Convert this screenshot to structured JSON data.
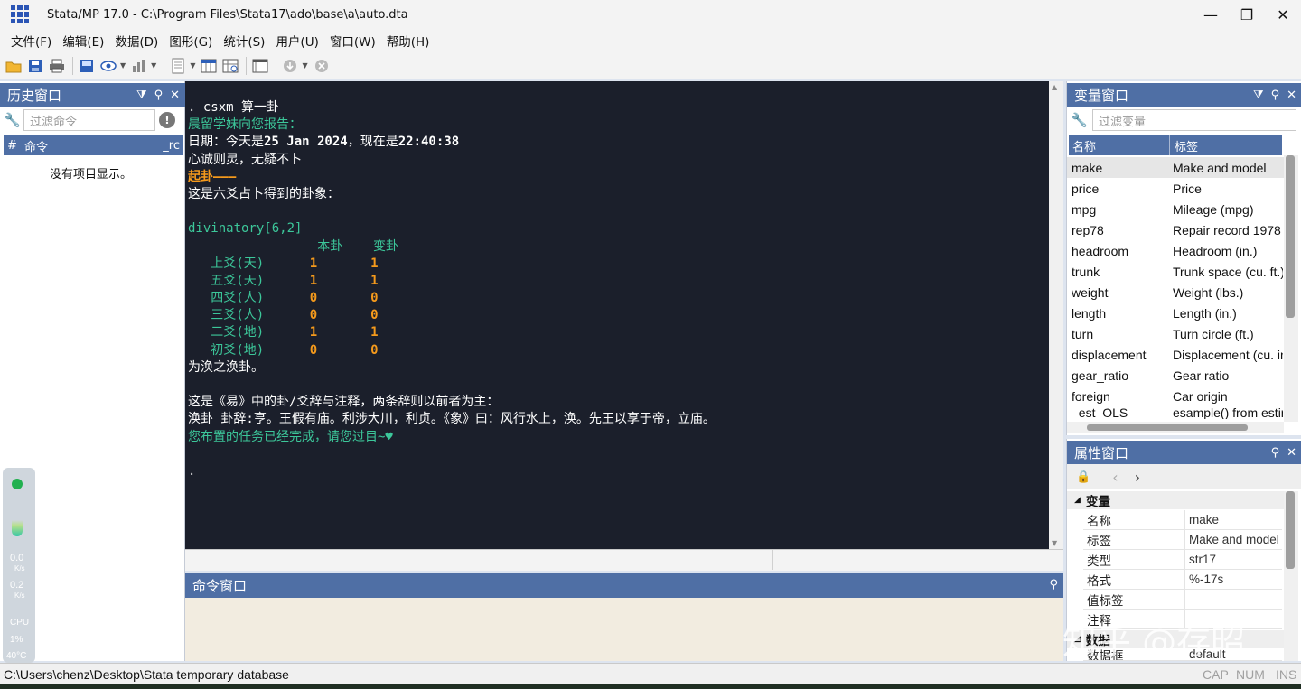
{
  "window": {
    "title": "Stata/MP 17.0 - C:\\Program Files\\Stata17\\ado\\base\\a\\auto.dta",
    "minimize": "—",
    "restore": "❐",
    "close": "✕"
  },
  "menu": [
    "文件(F)",
    "编辑(E)",
    "数据(D)",
    "图形(G)",
    "统计(S)",
    "用户(U)",
    "窗口(W)",
    "帮助(H)"
  ],
  "history": {
    "title": "历史窗口",
    "filter_placeholder": "过滤命令",
    "col_num": "#",
    "col_cmd": "命令",
    "col_rc": "_rc",
    "empty": "没有项目显示。"
  },
  "results": {
    "lines": [
      [
        {
          "t": ". csxm 算一卦",
          "c": "white"
        }
      ],
      [
        {
          "t": "晨留学妹向您报告：",
          "c": "green"
        }
      ],
      [
        {
          "t": "日期：今天是",
          "c": "white"
        },
        {
          "t": "25 Jan 2024",
          "c": "bold"
        },
        {
          "t": "，现在是",
          "c": "white"
        },
        {
          "t": "22:40:38",
          "c": "bold"
        }
      ],
      [
        {
          "t": "心诚则灵，无疑不卜",
          "c": "white"
        }
      ],
      [
        {
          "t": "起卦———",
          "c": "orange"
        }
      ],
      [
        {
          "t": "这是六爻占卜得到的卦象：",
          "c": "white"
        }
      ],
      [
        {
          "t": "",
          "c": "white"
        }
      ],
      [
        {
          "t": "divinatory[6,2]",
          "c": "green"
        }
      ],
      [
        {
          "t": "                 本卦    变卦",
          "c": "green"
        }
      ],
      [
        {
          "t": "   上爻(天)      ",
          "c": "green"
        },
        {
          "t": "1       1",
          "c": "orange"
        }
      ],
      [
        {
          "t": "   五爻(天)      ",
          "c": "green"
        },
        {
          "t": "1       1",
          "c": "orange"
        }
      ],
      [
        {
          "t": "   四爻(人)      ",
          "c": "green"
        },
        {
          "t": "0       0",
          "c": "orange"
        }
      ],
      [
        {
          "t": "   三爻(人)      ",
          "c": "green"
        },
        {
          "t": "0       0",
          "c": "orange"
        }
      ],
      [
        {
          "t": "   二爻(地)      ",
          "c": "green"
        },
        {
          "t": "1       1",
          "c": "orange"
        }
      ],
      [
        {
          "t": "   初爻(地)      ",
          "c": "green"
        },
        {
          "t": "0       0",
          "c": "orange"
        }
      ],
      [
        {
          "t": "为涣之涣卦。",
          "c": "white"
        }
      ],
      [
        {
          "t": "",
          "c": "white"
        }
      ],
      [
        {
          "t": "这是《易》中的卦/爻辞与注释，两条辞则以前者为主：",
          "c": "white"
        }
      ],
      [
        {
          "t": "涣卦 卦辞:亨。王假有庙。利涉大川，利贞。《象》曰：风行水上，涣。先王以享于帝，立庙。",
          "c": "white"
        }
      ],
      [
        {
          "t": "您布置的任务已经完成，请您过目~♥",
          "c": "green"
        }
      ],
      [
        {
          "t": "",
          "c": "white"
        }
      ],
      [
        {
          "t": ".",
          "c": "white"
        }
      ]
    ]
  },
  "command": {
    "title": "命令窗口"
  },
  "variables": {
    "title": "变量窗口",
    "filter_placeholder": "过滤变量",
    "col_name": "名称",
    "col_label": "标签",
    "rows": [
      {
        "name": "make",
        "label": "Make and model"
      },
      {
        "name": "price",
        "label": "Price"
      },
      {
        "name": "mpg",
        "label": "Mileage (mpg)"
      },
      {
        "name": "rep78",
        "label": "Repair record 1978"
      },
      {
        "name": "headroom",
        "label": "Headroom (in.)"
      },
      {
        "name": "trunk",
        "label": "Trunk space (cu. ft.)"
      },
      {
        "name": "weight",
        "label": "Weight (lbs.)"
      },
      {
        "name": "length",
        "label": "Length (in.)"
      },
      {
        "name": "turn",
        "label": "Turn circle (ft.)"
      },
      {
        "name": "displacement",
        "label": "Displacement (cu. in.)"
      },
      {
        "name": "gear_ratio",
        "label": "Gear ratio"
      },
      {
        "name": "foreign",
        "label": "Car origin"
      },
      {
        "name": "_est_OLS",
        "label": "esample() from estimates"
      }
    ]
  },
  "properties": {
    "title": "属性窗口",
    "section_var": "变量",
    "section_data": "数据",
    "rows": [
      {
        "name": "名称",
        "value": "make"
      },
      {
        "name": "标签",
        "value": "Make and model"
      },
      {
        "name": "类型",
        "value": "str17"
      },
      {
        "name": "格式",
        "value": "%-17s"
      },
      {
        "name": "值标签",
        "value": ""
      },
      {
        "name": "注释",
        "value": ""
      }
    ],
    "data_row": {
      "name": "数据框",
      "value": "default"
    }
  },
  "status": {
    "path": "C:\\Users\\chenz\\Desktop\\Stata temporary database",
    "cap": "CAP",
    "num": "NUM",
    "ins": "INS"
  },
  "monitor": {
    "up": "0.0",
    "up_unit": "K/s",
    "down": "0.2",
    "down_unit": "K/s",
    "cpu_label": "CPU",
    "cpu": "1%",
    "temp": "40°C"
  },
  "watermark": "知乎 @存昭",
  "colors": {
    "panel_header": "#4f6fa5",
    "results_bg": "#1b1f2b",
    "result_green": "#3cc79a",
    "result_orange": "#f59a1c",
    "command_bg": "#f2ece0"
  }
}
